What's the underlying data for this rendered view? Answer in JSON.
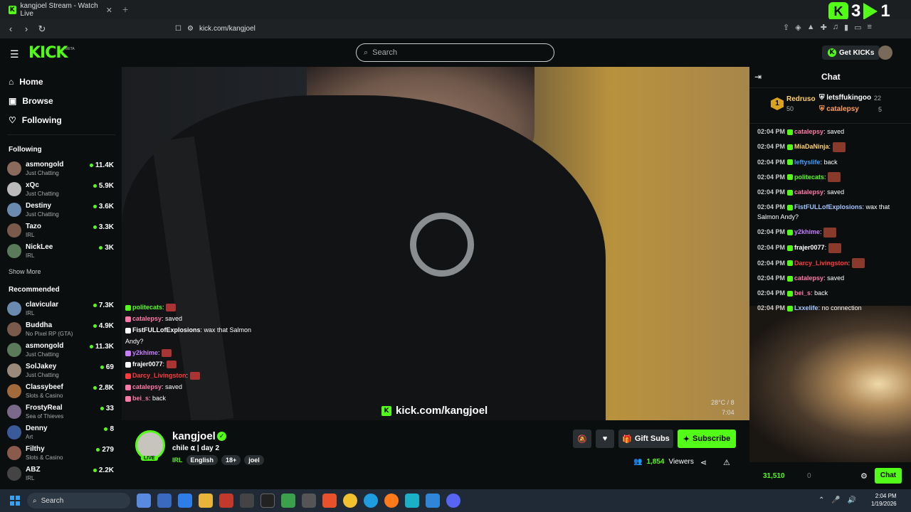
{
  "browser": {
    "tab_title": "kangjoel Stream - Watch Live",
    "url": "kick.com/kangjoel",
    "overlay_counts": [
      "3",
      "1"
    ]
  },
  "header": {
    "logo": "KICK",
    "logo_badge": "BETA",
    "search_placeholder": "Search",
    "get_kicks_label": "Get KICKs"
  },
  "sidebar": {
    "nav": [
      {
        "label": "Home",
        "icon": "home-icon"
      },
      {
        "label": "Browse",
        "icon": "browse-icon"
      },
      {
        "label": "Following",
        "icon": "heart-icon"
      }
    ],
    "following_title": "Following",
    "following": [
      {
        "name": "asmongold",
        "category": "Just Chatting",
        "viewers": "11.4K"
      },
      {
        "name": "xQc",
        "category": "Just Chatting",
        "viewers": "5.9K"
      },
      {
        "name": "Destiny",
        "category": "Just Chatting",
        "viewers": "3.6K"
      },
      {
        "name": "Tazo",
        "category": "IRL",
        "viewers": "3.3K"
      },
      {
        "name": "NickLee",
        "category": "IRL",
        "viewers": "3K"
      }
    ],
    "show_more": "Show More",
    "recommended_title": "Recommended",
    "recommended": [
      {
        "name": "clavicular",
        "category": "IRL",
        "viewers": "7.3K"
      },
      {
        "name": "Buddha",
        "category": "No Pixel RP (GTA)",
        "viewers": "4.9K"
      },
      {
        "name": "asmongold",
        "category": "Just Chatting",
        "viewers": "11.3K"
      },
      {
        "name": "SolJakey",
        "category": "Just Chatting",
        "viewers": "69"
      },
      {
        "name": "Classybeef",
        "category": "Slots & Casino",
        "viewers": "2.8K"
      },
      {
        "name": "FrostyReal",
        "category": "Sea of Thieves",
        "viewers": "33"
      },
      {
        "name": "Denny",
        "category": "Art",
        "viewers": "8"
      },
      {
        "name": "Filthy",
        "category": "Slots & Casino",
        "viewers": "279"
      },
      {
        "name": "ABZ",
        "category": "IRL",
        "viewers": "2.2K"
      }
    ]
  },
  "video": {
    "watermark": "kick.com/kangjoel",
    "temp": "28°C / 8",
    "time": "7:04",
    "overlay_chat": [
      {
        "user": "politecats",
        "text": "",
        "color": "#53fc18"
      },
      {
        "user": "catalepsy",
        "text": "saved",
        "color": "#ff7aa8"
      },
      {
        "user": "FistFULLofExplosions",
        "text": "wax that Salmon Andy?",
        "color": "#ffffff"
      },
      {
        "user": "y2khime",
        "text": "",
        "color": "#c77dff"
      },
      {
        "user": "frajer0077",
        "text": "",
        "color": "#ffffff"
      },
      {
        "user": "Darcy_Livingston",
        "text": "",
        "color": "#ff3b3b"
      },
      {
        "user": "catalepsy",
        "text": "saved",
        "color": "#ff7aa8"
      },
      {
        "user": "bei_s",
        "text": "back",
        "color": "#ff7aa8"
      }
    ]
  },
  "channel": {
    "name": "kangjoel",
    "title": "chile ⍺ | day 2",
    "live_label": "LIVE",
    "category": "IRL",
    "tags": [
      "English",
      "18+",
      "joel"
    ],
    "gift_subs_label": "Gift Subs",
    "subscribe_label": "Subscribe",
    "viewers": "1,854",
    "viewers_label": "Viewers"
  },
  "chat": {
    "title": "Chat",
    "leaderboard": [
      {
        "rank": "1",
        "name": "Redruso",
        "value": "50"
      },
      {
        "name": "letsffukingoo",
        "value": "22"
      },
      {
        "name": "catalepsy",
        "value": "5"
      }
    ],
    "messages": [
      {
        "time": "02:04 PM",
        "user": "catalepsy",
        "text": "saved",
        "color": "#ff7aa8",
        "emote": false
      },
      {
        "time": "02:04 PM",
        "user": "MiaDaNinja",
        "text": "",
        "color": "#ffd166",
        "emote": true
      },
      {
        "time": "02:04 PM",
        "user": "leftyslife",
        "text": "back",
        "color": "#3aa0ff",
        "emote": false
      },
      {
        "time": "02:04 PM",
        "user": "politecats",
        "text": "",
        "color": "#53fc18",
        "emote": true
      },
      {
        "time": "02:04 PM",
        "user": "catalepsy",
        "text": "saved",
        "color": "#ff7aa8",
        "emote": false
      },
      {
        "time": "02:04 PM",
        "user": "FistFULLofExplosions",
        "text": "wax that Salmon Andy?",
        "color": "#9ec5ff",
        "emote": false
      },
      {
        "time": "02:04 PM",
        "user": "y2khime",
        "text": "",
        "color": "#c77dff",
        "emote": true
      },
      {
        "time": "02:04 PM",
        "user": "frajer0077",
        "text": "",
        "color": "#ffffff",
        "emote": true
      },
      {
        "time": "02:04 PM",
        "user": "Darcy_Livingston",
        "text": "",
        "color": "#ff3b3b",
        "emote": true
      },
      {
        "time": "02:04 PM",
        "user": "catalepsy",
        "text": "saved",
        "color": "#ff7aa8",
        "emote": false
      },
      {
        "time": "02:04 PM",
        "user": "bei_s",
        "text": "back",
        "color": "#ff7aa8",
        "emote": false
      },
      {
        "time": "02:04 PM",
        "user": "Lxxelife",
        "text": "no connection",
        "color": "#9ec5ff",
        "emote": false
      }
    ],
    "kicks_amount": "31,510",
    "zero_count": "0",
    "chat_button": "Chat"
  },
  "taskbar": {
    "search_placeholder": "Search",
    "time": "2:04 PM",
    "date": "1/19/2026"
  },
  "colors": {
    "accent": "#53fc18"
  }
}
